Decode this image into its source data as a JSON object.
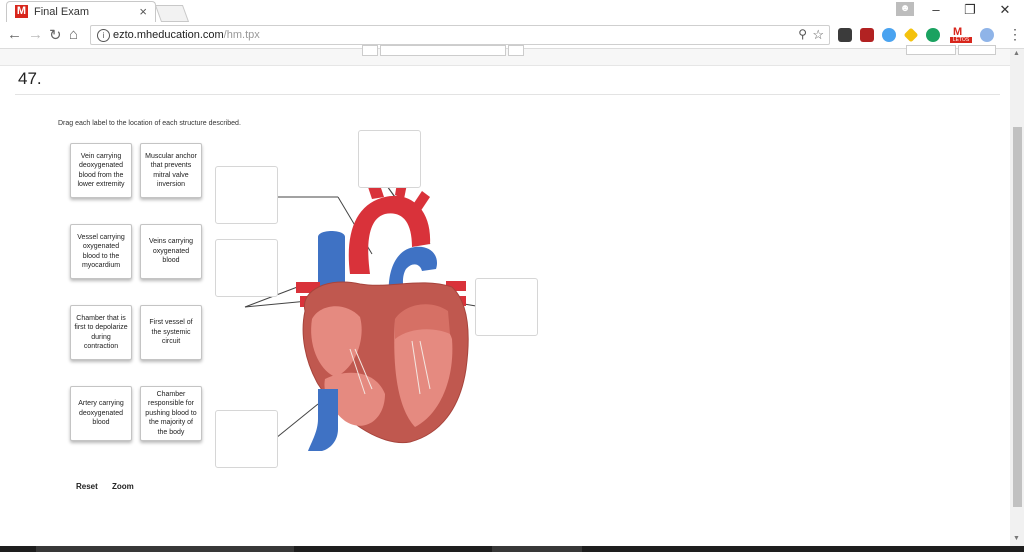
{
  "browser": {
    "tab_logo": "M",
    "tab_title": "Final Exam",
    "tab_close": "×",
    "url_host": "ezto.mheducation.com",
    "url_path": "/hm.tpx",
    "window_controls": {
      "minimize": "–",
      "restore": "❐",
      "close": "✕"
    },
    "ext_badge": "LETOS"
  },
  "question": {
    "number": "47.",
    "instruction": "Drag each label to the location of each structure described."
  },
  "labels": [
    {
      "text": "Vein carrying deoxygenated blood from the lower extremity"
    },
    {
      "text": "Muscular anchor that prevents mitral valve inversion"
    },
    {
      "text": "Vessel carrying oxygenated blood to the myocardium"
    },
    {
      "text": "Veins carrying oxygenated blood"
    },
    {
      "text": "Chamber that is first to depolarize during contraction"
    },
    {
      "text": "First vessel of the systemic circuit"
    },
    {
      "text": "Artery carrying deoxygenated blood"
    },
    {
      "text": "Chamber responsible for pushing blood to the majority of the body"
    }
  ],
  "controls": {
    "reset": "Reset",
    "zoom": "Zoom"
  },
  "colors": {
    "artery_red": "#d9323a",
    "vein_blue": "#3f72c4",
    "muscle": "#c0584f",
    "fat_yellow": "#e9c44a"
  }
}
